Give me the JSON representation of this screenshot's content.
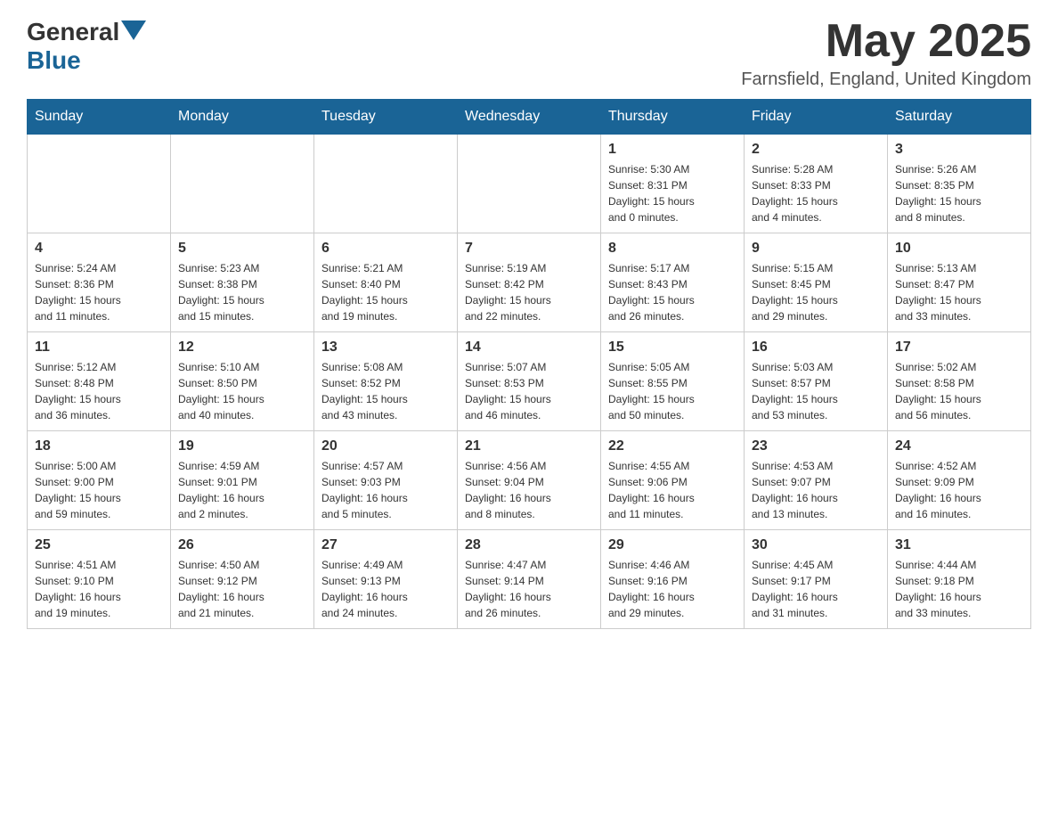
{
  "header": {
    "logo_text_general": "General",
    "logo_text_blue": "Blue",
    "month_year": "May 2025",
    "location": "Farnsfield, England, United Kingdom"
  },
  "days_of_week": [
    "Sunday",
    "Monday",
    "Tuesday",
    "Wednesday",
    "Thursday",
    "Friday",
    "Saturday"
  ],
  "weeks": [
    {
      "days": [
        {
          "date": "",
          "info": ""
        },
        {
          "date": "",
          "info": ""
        },
        {
          "date": "",
          "info": ""
        },
        {
          "date": "",
          "info": ""
        },
        {
          "date": "1",
          "info": "Sunrise: 5:30 AM\nSunset: 8:31 PM\nDaylight: 15 hours\nand 0 minutes."
        },
        {
          "date": "2",
          "info": "Sunrise: 5:28 AM\nSunset: 8:33 PM\nDaylight: 15 hours\nand 4 minutes."
        },
        {
          "date": "3",
          "info": "Sunrise: 5:26 AM\nSunset: 8:35 PM\nDaylight: 15 hours\nand 8 minutes."
        }
      ]
    },
    {
      "days": [
        {
          "date": "4",
          "info": "Sunrise: 5:24 AM\nSunset: 8:36 PM\nDaylight: 15 hours\nand 11 minutes."
        },
        {
          "date": "5",
          "info": "Sunrise: 5:23 AM\nSunset: 8:38 PM\nDaylight: 15 hours\nand 15 minutes."
        },
        {
          "date": "6",
          "info": "Sunrise: 5:21 AM\nSunset: 8:40 PM\nDaylight: 15 hours\nand 19 minutes."
        },
        {
          "date": "7",
          "info": "Sunrise: 5:19 AM\nSunset: 8:42 PM\nDaylight: 15 hours\nand 22 minutes."
        },
        {
          "date": "8",
          "info": "Sunrise: 5:17 AM\nSunset: 8:43 PM\nDaylight: 15 hours\nand 26 minutes."
        },
        {
          "date": "9",
          "info": "Sunrise: 5:15 AM\nSunset: 8:45 PM\nDaylight: 15 hours\nand 29 minutes."
        },
        {
          "date": "10",
          "info": "Sunrise: 5:13 AM\nSunset: 8:47 PM\nDaylight: 15 hours\nand 33 minutes."
        }
      ]
    },
    {
      "days": [
        {
          "date": "11",
          "info": "Sunrise: 5:12 AM\nSunset: 8:48 PM\nDaylight: 15 hours\nand 36 minutes."
        },
        {
          "date": "12",
          "info": "Sunrise: 5:10 AM\nSunset: 8:50 PM\nDaylight: 15 hours\nand 40 minutes."
        },
        {
          "date": "13",
          "info": "Sunrise: 5:08 AM\nSunset: 8:52 PM\nDaylight: 15 hours\nand 43 minutes."
        },
        {
          "date": "14",
          "info": "Sunrise: 5:07 AM\nSunset: 8:53 PM\nDaylight: 15 hours\nand 46 minutes."
        },
        {
          "date": "15",
          "info": "Sunrise: 5:05 AM\nSunset: 8:55 PM\nDaylight: 15 hours\nand 50 minutes."
        },
        {
          "date": "16",
          "info": "Sunrise: 5:03 AM\nSunset: 8:57 PM\nDaylight: 15 hours\nand 53 minutes."
        },
        {
          "date": "17",
          "info": "Sunrise: 5:02 AM\nSunset: 8:58 PM\nDaylight: 15 hours\nand 56 minutes."
        }
      ]
    },
    {
      "days": [
        {
          "date": "18",
          "info": "Sunrise: 5:00 AM\nSunset: 9:00 PM\nDaylight: 15 hours\nand 59 minutes."
        },
        {
          "date": "19",
          "info": "Sunrise: 4:59 AM\nSunset: 9:01 PM\nDaylight: 16 hours\nand 2 minutes."
        },
        {
          "date": "20",
          "info": "Sunrise: 4:57 AM\nSunset: 9:03 PM\nDaylight: 16 hours\nand 5 minutes."
        },
        {
          "date": "21",
          "info": "Sunrise: 4:56 AM\nSunset: 9:04 PM\nDaylight: 16 hours\nand 8 minutes."
        },
        {
          "date": "22",
          "info": "Sunrise: 4:55 AM\nSunset: 9:06 PM\nDaylight: 16 hours\nand 11 minutes."
        },
        {
          "date": "23",
          "info": "Sunrise: 4:53 AM\nSunset: 9:07 PM\nDaylight: 16 hours\nand 13 minutes."
        },
        {
          "date": "24",
          "info": "Sunrise: 4:52 AM\nSunset: 9:09 PM\nDaylight: 16 hours\nand 16 minutes."
        }
      ]
    },
    {
      "days": [
        {
          "date": "25",
          "info": "Sunrise: 4:51 AM\nSunset: 9:10 PM\nDaylight: 16 hours\nand 19 minutes."
        },
        {
          "date": "26",
          "info": "Sunrise: 4:50 AM\nSunset: 9:12 PM\nDaylight: 16 hours\nand 21 minutes."
        },
        {
          "date": "27",
          "info": "Sunrise: 4:49 AM\nSunset: 9:13 PM\nDaylight: 16 hours\nand 24 minutes."
        },
        {
          "date": "28",
          "info": "Sunrise: 4:47 AM\nSunset: 9:14 PM\nDaylight: 16 hours\nand 26 minutes."
        },
        {
          "date": "29",
          "info": "Sunrise: 4:46 AM\nSunset: 9:16 PM\nDaylight: 16 hours\nand 29 minutes."
        },
        {
          "date": "30",
          "info": "Sunrise: 4:45 AM\nSunset: 9:17 PM\nDaylight: 16 hours\nand 31 minutes."
        },
        {
          "date": "31",
          "info": "Sunrise: 4:44 AM\nSunset: 9:18 PM\nDaylight: 16 hours\nand 33 minutes."
        }
      ]
    }
  ]
}
